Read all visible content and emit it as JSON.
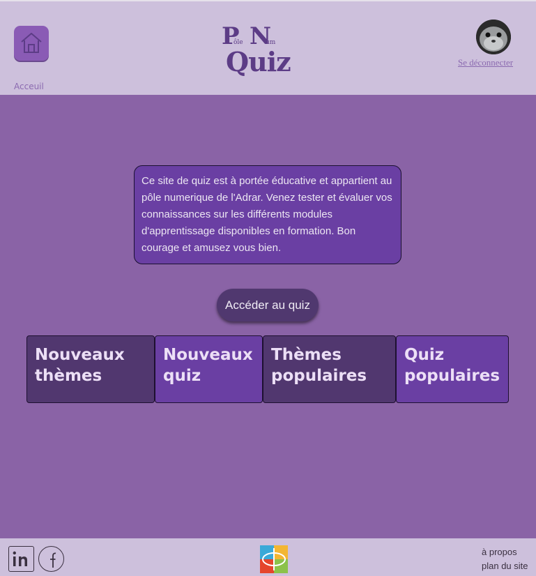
{
  "header": {
    "home_label": "Acceuil",
    "logo": {
      "p": "P",
      "ole": "ôle",
      "n": "N",
      "um": "um",
      "quiz": "Quiz"
    },
    "logout_label": "Se déconnecter"
  },
  "main": {
    "intro_text": "Ce site de quiz est à portée éducative et appartient au pôle numerique de l'Adrar. Venez tester et évaluer vos connaissances sur les différents modules d'apprentissage disponibles en formation. Bon courage et amusez vous bien.",
    "cta_label": "Accéder au quiz",
    "cards": [
      {
        "label": "Nouveaux thèmes"
      },
      {
        "label": "Nouveaux quiz"
      },
      {
        "label": "Thèmes populaires"
      },
      {
        "label": "Quiz populaires"
      }
    ]
  },
  "footer": {
    "social_icons": [
      "linkedin-icon",
      "facebook-icon"
    ],
    "links": [
      "à propos",
      "plan du site"
    ]
  },
  "colors": {
    "header_bg": "#cdc0dc",
    "body_bg": "#8a63a6",
    "card_dark": "#51376f",
    "card_light": "#6a3fa3",
    "accent": "#8a5bb5"
  }
}
